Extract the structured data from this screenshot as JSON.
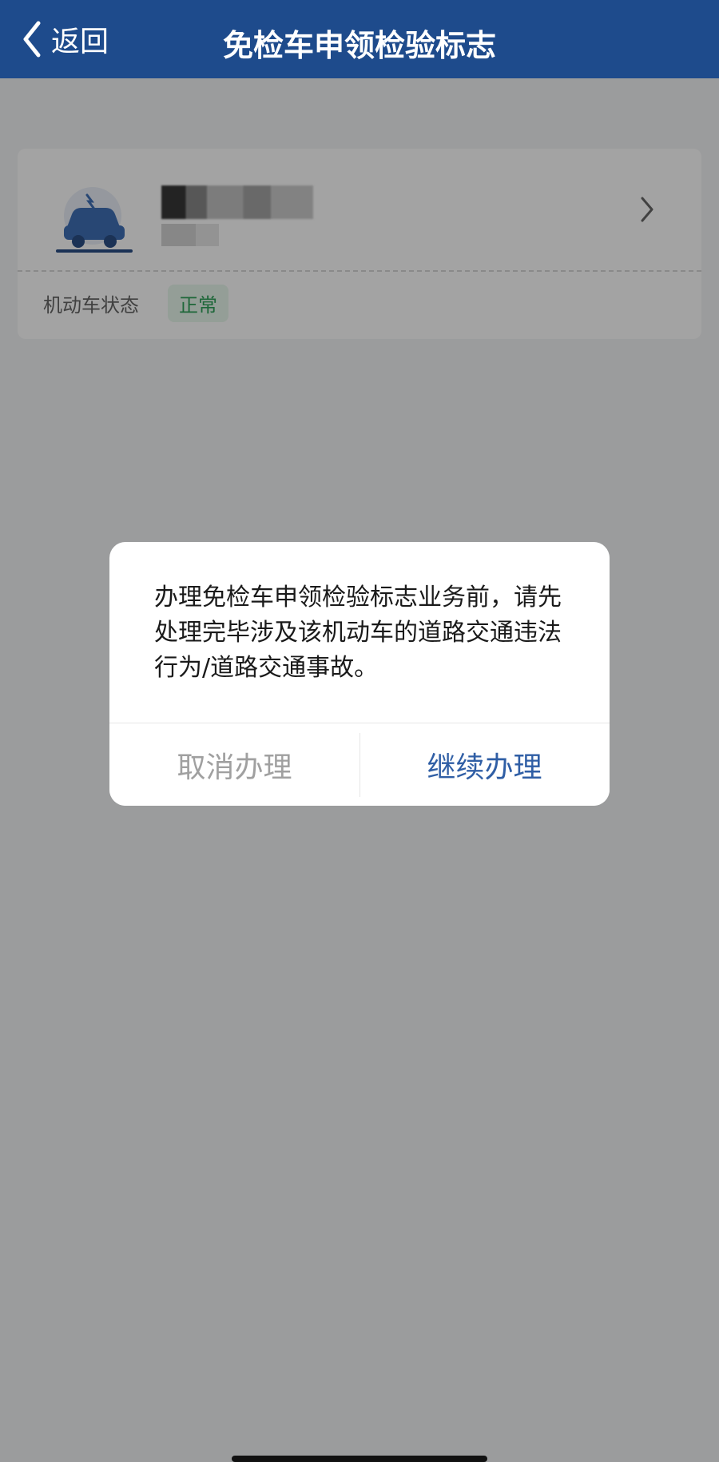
{
  "nav": {
    "back_label": "返回",
    "title": "免检车申领检验标志"
  },
  "vehicle_card": {
    "status_label": "机动车状态",
    "status_value": "正常"
  },
  "dialog": {
    "message": "办理免检车申领检验标志业务前，请先处理完毕涉及该机动车的道路交通违法行为/道路交通事故。",
    "cancel_label": "取消办理",
    "continue_label": "继续办理"
  },
  "colors": {
    "navbar": "#1e4b8c",
    "accent": "#2f5ea5",
    "status_green": "#2fa15a"
  },
  "icons": {
    "back": "chevron-left-icon",
    "card_arrow": "chevron-right-icon",
    "vehicle": "car-icon"
  }
}
